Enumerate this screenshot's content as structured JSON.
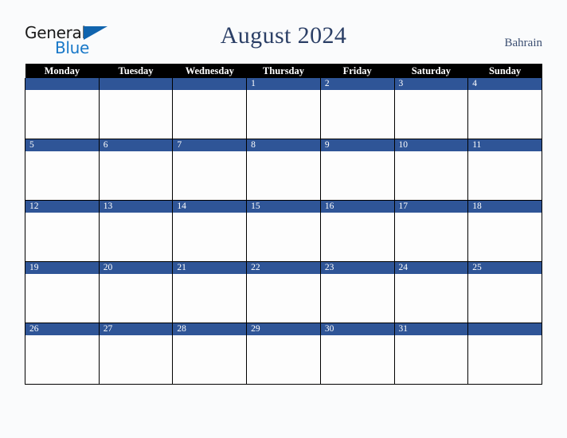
{
  "logo": {
    "line1": "General",
    "line2": "Blue",
    "triangle_color": "#1064ae"
  },
  "header": {
    "title": "August 2024",
    "country": "Bahrain"
  },
  "calendar": {
    "weekday_headers": [
      "Monday",
      "Tuesday",
      "Wednesday",
      "Thursday",
      "Friday",
      "Saturday",
      "Sunday"
    ],
    "accent_color": "#2f5597",
    "header_bg": "#000000",
    "weeks": [
      [
        "",
        "",
        "",
        "1",
        "2",
        "3",
        "4"
      ],
      [
        "5",
        "6",
        "7",
        "8",
        "9",
        "10",
        "11"
      ],
      [
        "12",
        "13",
        "14",
        "15",
        "16",
        "17",
        "18"
      ],
      [
        "19",
        "20",
        "21",
        "22",
        "23",
        "24",
        "25"
      ],
      [
        "26",
        "27",
        "28",
        "29",
        "30",
        "31",
        ""
      ]
    ]
  }
}
